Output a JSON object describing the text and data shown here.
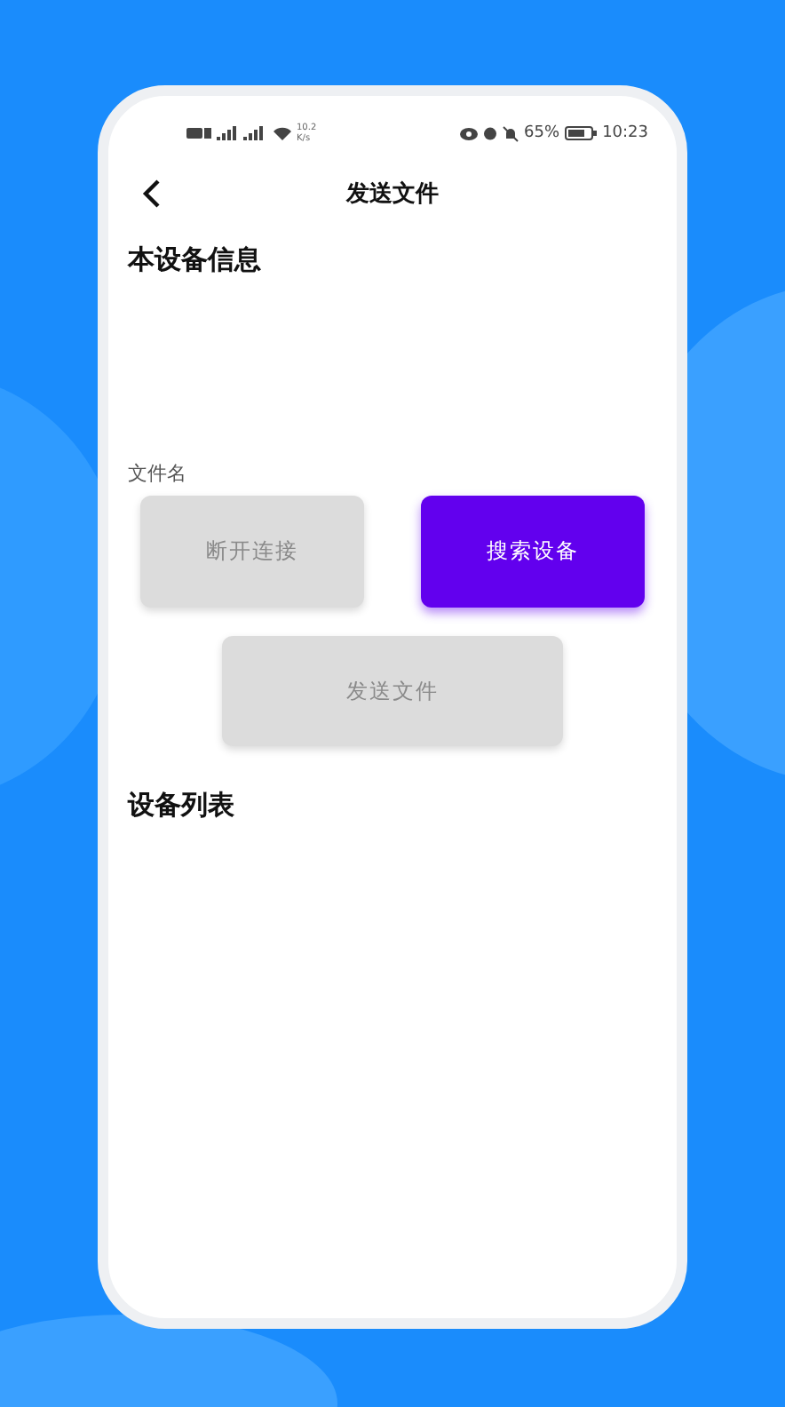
{
  "status_bar": {
    "speed": "10.2",
    "speed_unit": "K/s",
    "battery_percent": "65%",
    "time": "10:23"
  },
  "header": {
    "title": "发送文件"
  },
  "device_info": {
    "heading": "本设备信息"
  },
  "file": {
    "label": "文件名"
  },
  "buttons": [
    {
      "label": "断开连接",
      "disabled": true
    },
    {
      "label": "搜索设备",
      "disabled": false
    },
    {
      "label": "发送文件",
      "disabled": true
    }
  ],
  "device_list": {
    "heading": "设备列表"
  }
}
